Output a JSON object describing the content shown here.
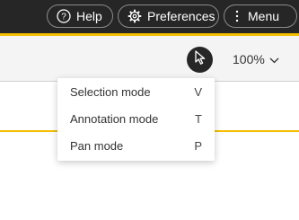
{
  "header": {
    "help_label": "Help",
    "preferences_label": "Preferences",
    "menu_label": "Menu",
    "help_icon": "question-circle-icon",
    "preferences_icon": "gear-icon",
    "menu_icon": "vertical-dots-icon"
  },
  "toolbar": {
    "cursor_icon": "mouse-pointer-icon",
    "zoom_value": "100%"
  },
  "mode_menu": {
    "items": [
      {
        "label": "Selection mode",
        "shortcut": "V"
      },
      {
        "label": "Annotation mode",
        "shortcut": "T"
      },
      {
        "label": "Pan mode",
        "shortcut": "P"
      }
    ]
  },
  "colors": {
    "topbar": "#262626",
    "accent": "#f3bd00",
    "toolbar": "#f4f4f4"
  }
}
